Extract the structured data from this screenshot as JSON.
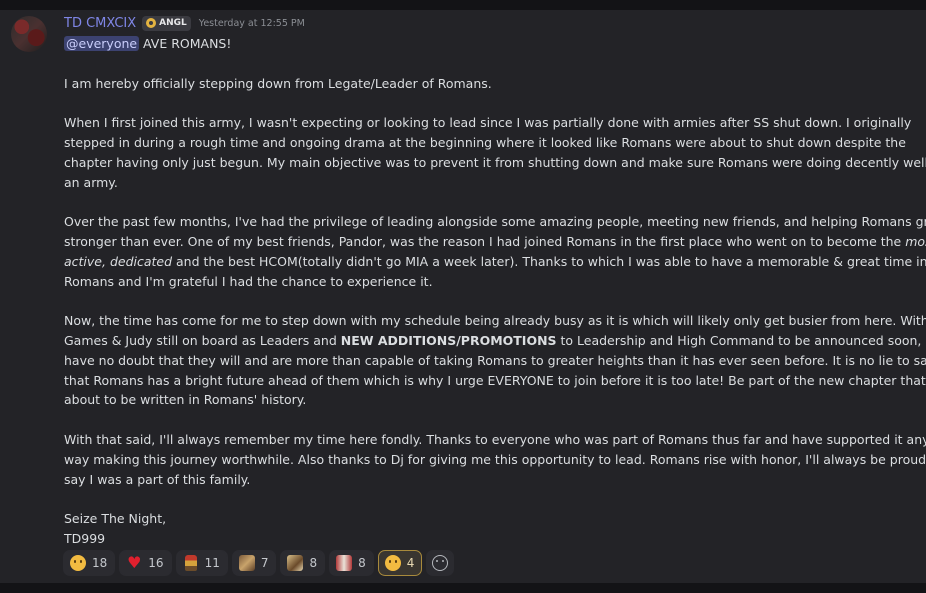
{
  "message": {
    "author": "TD CMXCIX",
    "tag": "ANGL",
    "timestamp": "Yesterday at 12:55 PM",
    "mention": "@everyone",
    "lines": {
      "l0": " AVE ROMANS!",
      "l1": "I am hereby officially stepping down from Legate/Leader of Romans.",
      "l2": "When I first joined this army, I wasn't expecting or looking to lead since I was partially done with armies after SS shut down. I originally",
      "l3": "stepped in during a rough time and ongoing drama at the beginning where it looked like Romans were about to shut down despite the",
      "l4": "chapter having only just begun. My main objective was to prevent it from shutting down and make sure Romans were doing decently well as",
      "l5": "an army.",
      "l6": "Over the past few months, I've had the privilege of leading alongside some amazing people, meeting new friends, and helping Romans grow",
      "l7a": "stronger than ever. One of my best friends, Pandor, was the reason I had joined Romans in the first place who went on to become the ",
      "l7b": "most",
      "l8a": "active, dedicated",
      "l8b": " and the best HCOM(totally didn't go MIA a week later). Thanks to which I was able to have a memorable & great time in",
      "l9": "Romans and I'm grateful I had the chance to experience it.",
      "l10": "Now, the time has come for me to step down with my schedule being already busy as it is which will likely only get busier from here. With",
      "l11a": "Games & Judy still on board as Leaders and ",
      "l11b": "NEW ADDITIONS/PROMOTIONS",
      "l11c": " to Leadership and High Command to be announced soon, I",
      "l12": "have no doubt that they will and are more than capable of taking Romans to greater heights than it has ever seen before. It is no lie to say",
      "l13": "that Romans has a bright future ahead of them which is why I urge EVERYONE to join before it is too late! Be part of the new chapter that is",
      "l14": "about to be written in Romans' history.",
      "l15": "With that said, I'll always remember my time here fondly. Thanks to everyone who was part of Romans thus far and have supported it any",
      "l16": "way making this journey worthwhile. Also thanks to Dj for giving me this opportunity to lead. Romans rise with honor, I'll always be proud to",
      "l17": "say I was a part of this family.",
      "l18": "Seize The Night,",
      "l19": "TD999"
    }
  },
  "reactions": [
    {
      "emoji": "disappointed-face",
      "count": "18",
      "active": false
    },
    {
      "emoji": "red-heart",
      "count": "16",
      "active": false
    },
    {
      "emoji": "roman-soldier",
      "count": "11",
      "active": false
    },
    {
      "emoji": "custom-emoji-art-1",
      "count": "7",
      "active": false
    },
    {
      "emoji": "custom-emoji-art-2",
      "count": "8",
      "active": false
    },
    {
      "emoji": "custom-emoji-art-3",
      "count": "8",
      "active": false
    },
    {
      "emoji": "disappointed-face",
      "count": "4",
      "active": true
    }
  ],
  "colors": {
    "username": "#7f86e6",
    "mention_bg": "#3c4270",
    "active_reaction_border": "#a88a3c"
  }
}
